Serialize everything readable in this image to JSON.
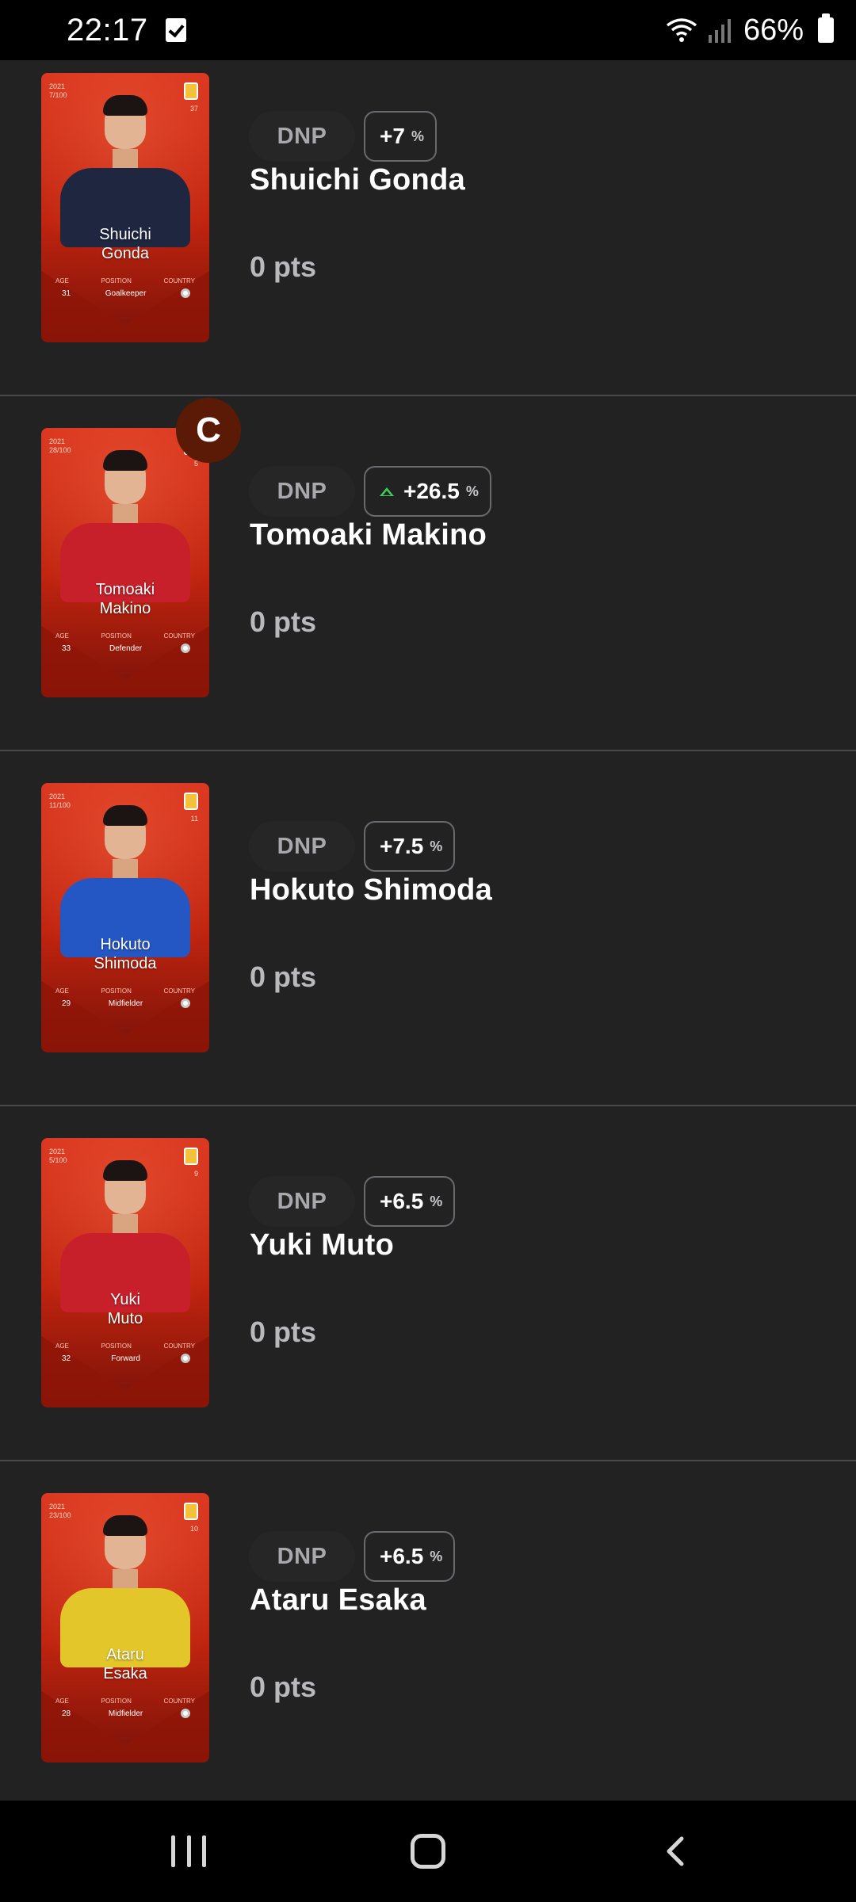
{
  "status_bar": {
    "time": "22:17",
    "battery": "66%"
  },
  "captain_badge": "C",
  "players": [
    {
      "name": "Shuichi Gonda",
      "card_first": "Shuichi",
      "card_last": "Gonda",
      "season": "2021",
      "serial": "7/100",
      "shirt_number": "37",
      "age": "31",
      "position": "Goalkeeper",
      "status": "DNP",
      "bonus": "+7",
      "bonus_up": false,
      "points": "0 pts",
      "shirt_color": "#1e2640"
    },
    {
      "name": "Tomoaki Makino",
      "card_first": "Tomoaki",
      "card_last": "Makino",
      "season": "2021",
      "serial": "28/100",
      "shirt_number": "5",
      "age": "33",
      "position": "Defender",
      "status": "DNP",
      "bonus": "+26.5",
      "bonus_up": true,
      "points": "0 pts",
      "shirt_color": "#c8202a"
    },
    {
      "name": "Hokuto Shimoda",
      "card_first": "Hokuto",
      "card_last": "Shimoda",
      "season": "2021",
      "serial": "11/100",
      "shirt_number": "11",
      "age": "29",
      "position": "Midfielder",
      "status": "DNP",
      "bonus": "+7.5",
      "bonus_up": false,
      "points": "0 pts",
      "shirt_color": "#2557c4"
    },
    {
      "name": "Yuki Muto",
      "card_first": "Yuki",
      "card_last": "Muto",
      "season": "2021",
      "serial": "5/100",
      "shirt_number": "9",
      "age": "32",
      "position": "Forward",
      "status": "DNP",
      "bonus": "+6.5",
      "bonus_up": false,
      "points": "0 pts",
      "shirt_color": "#c8202a"
    },
    {
      "name": "Ataru Esaka",
      "card_first": "Ataru",
      "card_last": "Esaka",
      "season": "2021",
      "serial": "23/100",
      "shirt_number": "10",
      "age": "28",
      "position": "Midfielder",
      "status": "DNP",
      "bonus": "+6.5",
      "bonus_up": false,
      "points": "0 pts",
      "shirt_color": "#e3c72a"
    }
  ],
  "card_labels": {
    "age": "AGE",
    "position": "POSITION",
    "country": "COUNTRY"
  },
  "bonus_unit_icon": "percent-icon",
  "colors": {
    "background": "#222223",
    "card_red": "#d8331c",
    "captain": "#5b1a06",
    "up_arrow": "#3ecf5b"
  }
}
